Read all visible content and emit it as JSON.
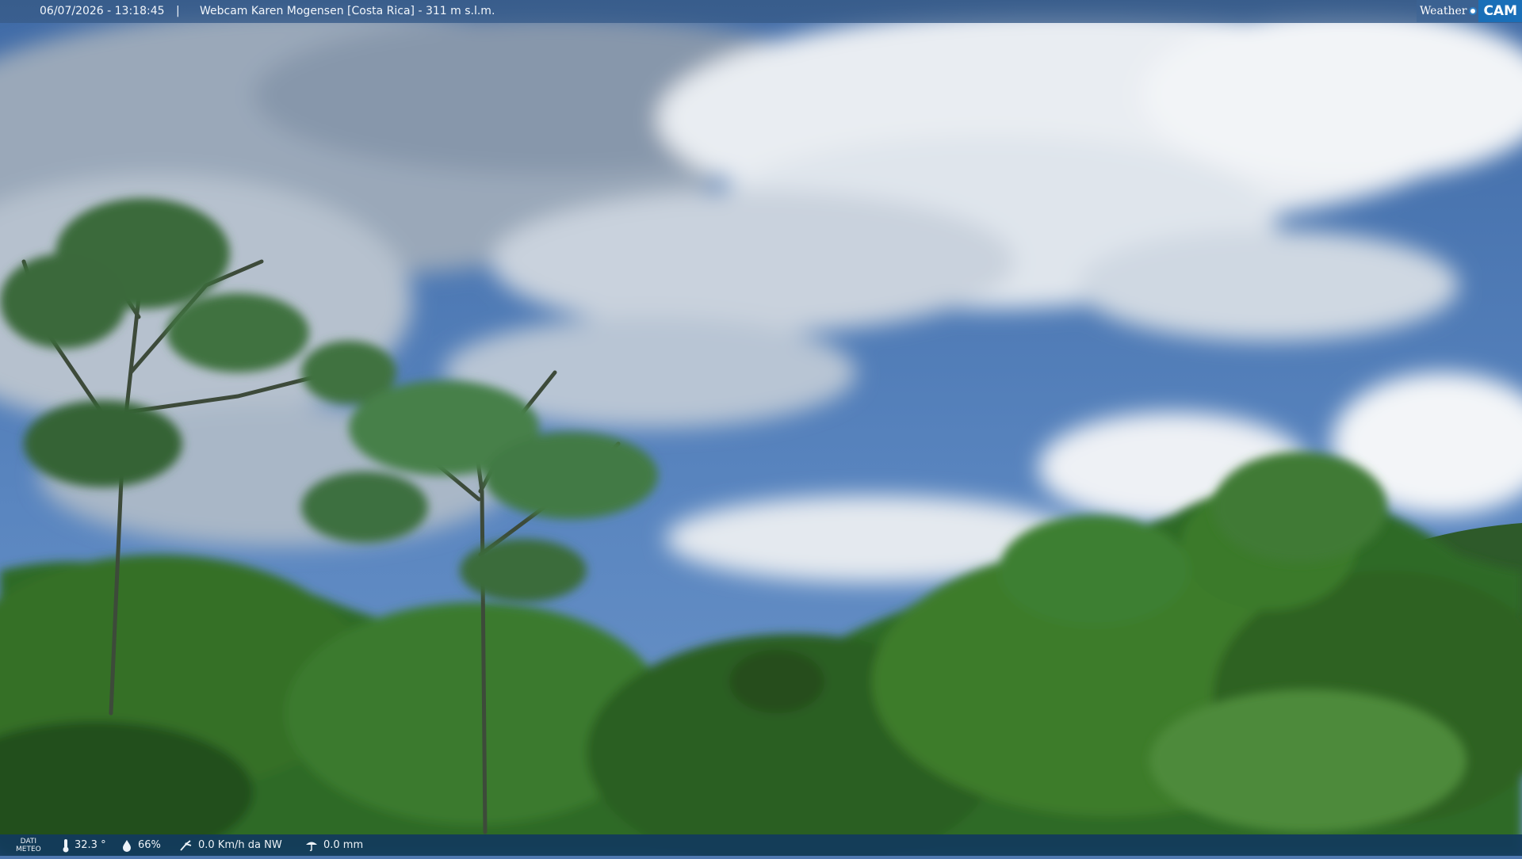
{
  "header": {
    "datetime": "06/07/2026 - 13:18:45",
    "separator": "|",
    "camera_title": "Webcam Karen Mogensen [Costa Rica]  - 311 m s.l.m."
  },
  "logo": {
    "left_text": "Weather",
    "right_text": "CAM"
  },
  "footer": {
    "label_line1": "DATI",
    "label_line2": "METEO",
    "temperature": "32.3 °",
    "humidity": "66%",
    "wind": "0.0 Km/h da NW",
    "rain": "0.0 mm"
  },
  "colors": {
    "sky": "#4f78b0",
    "header_bar": "#385c8a",
    "footer_bar": "#123a5c",
    "logo_blue": "#1a6fb8"
  },
  "icons": {
    "temperature": "thermometer-icon",
    "humidity": "humidity-drop-icon",
    "wind": "wind-icon",
    "rain": "rain-icon"
  }
}
